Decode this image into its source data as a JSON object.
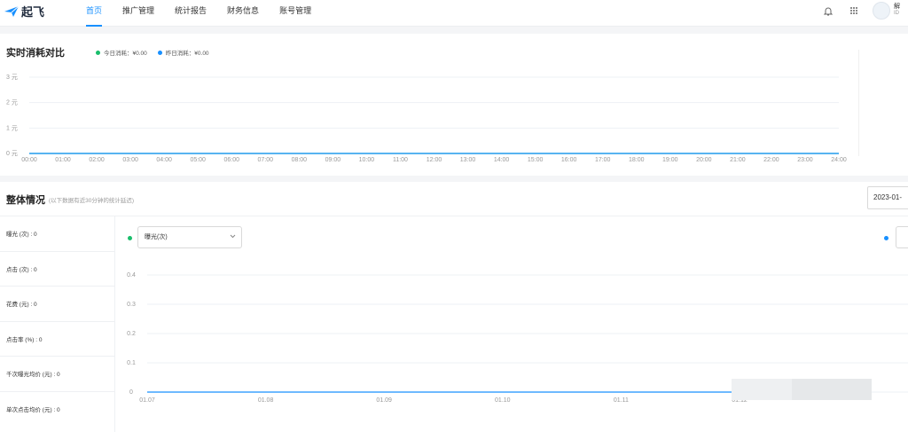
{
  "header": {
    "logo_text": "起飞",
    "nav": [
      "首页",
      "推广管理",
      "统计报告",
      "财务信息",
      "账号管理"
    ],
    "active_index": 0,
    "user_name": "解",
    "user_id": "ID"
  },
  "realtime": {
    "title": "实时消耗对比",
    "legend": [
      {
        "label": "今日消耗：¥0.00",
        "color": "#19be6b"
      },
      {
        "label": "昨日消耗：¥0.00",
        "color": "#1890ff"
      }
    ]
  },
  "overview": {
    "title": "整体情况",
    "subtitle": "(以下数据有近30分钟的统计延迟)",
    "date": "2023-01-",
    "metrics": [
      "曝光 (次) : 0",
      "点击 (次) : 0",
      "花费 (元) : 0",
      "点击率 (%) : 0",
      "千次曝光均价 (元) : 0",
      "单次点击均价 (元) : 0"
    ],
    "select_value": "曝光(次)",
    "dot_left_color": "#19be6b",
    "dot_right_color": "#1890ff"
  },
  "chart_data": [
    {
      "type": "line",
      "y_ticks": [
        "0 元",
        "1 元",
        "2 元",
        "3 元"
      ],
      "ylim": [
        0,
        3
      ],
      "x": [
        "00:00",
        "01:00",
        "02:00",
        "03:00",
        "04:00",
        "05:00",
        "06:00",
        "07:00",
        "08:00",
        "09:00",
        "10:00",
        "11:00",
        "12:00",
        "13:00",
        "14:00",
        "15:00",
        "16:00",
        "17:00",
        "18:00",
        "19:00",
        "20:00",
        "21:00",
        "22:00",
        "23:00",
        "24:00"
      ],
      "series": [
        {
          "name": "今日消耗：¥0.00",
          "color": "#19be6b",
          "values": [
            0,
            0,
            0,
            0,
            0,
            0,
            0,
            0,
            0,
            0,
            0,
            0,
            0,
            0,
            0,
            0,
            0,
            0,
            0,
            0,
            0,
            0,
            0,
            0,
            0
          ]
        },
        {
          "name": "昨日消耗：¥0.00",
          "color": "#1890ff",
          "values": [
            0,
            0,
            0,
            0,
            0,
            0,
            0,
            0,
            0,
            0,
            0,
            0,
            0,
            0,
            0,
            0,
            0,
            0,
            0,
            0,
            0,
            0,
            0,
            0,
            0
          ]
        }
      ],
      "grid": true
    },
    {
      "type": "line",
      "y_ticks": [
        "0",
        "0.1",
        "0.2",
        "0.3",
        "0.4"
      ],
      "ylim": [
        0,
        0.4
      ],
      "x": [
        "01.07",
        "01.08",
        "01.09",
        "01.10",
        "01.11",
        "01.12"
      ],
      "series": [
        {
          "color": "#1890ff",
          "values": [
            0,
            0,
            0,
            0,
            0,
            0
          ]
        }
      ],
      "grid": true
    }
  ]
}
